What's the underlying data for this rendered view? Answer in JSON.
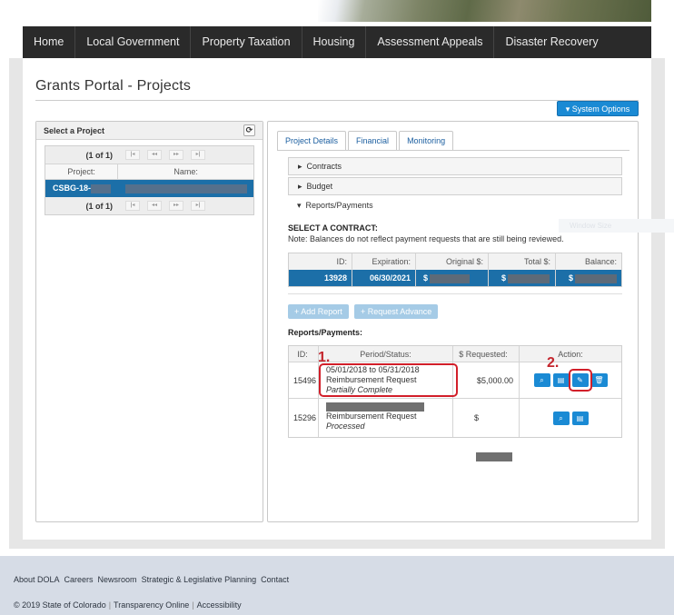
{
  "nav": [
    "Home",
    "Local Government",
    "Property Taxation",
    "Housing",
    "Assessment Appeals",
    "Disaster Recovery"
  ],
  "page_title": "Grants Portal - Projects",
  "system_options": "System Options",
  "left": {
    "header": "Select a Project",
    "pager_count": "(1 of 1)",
    "col_project": "Project:",
    "col_name": "Name:",
    "row_project": "CSBG-18-"
  },
  "tabs": [
    "Project Details",
    "Financial",
    "Monitoring"
  ],
  "accordions": {
    "contracts": "Contracts",
    "budget": "Budget",
    "reports": "Reports/Payments"
  },
  "select_contract": "SELECT A CONTRACT:",
  "contract_note": "Note: Balances do not reflect payment requests that are still being reviewed.",
  "contract_table": {
    "headers": [
      "ID:",
      "Expiration:",
      "Original $:",
      "Total $:",
      "Balance:"
    ],
    "row": {
      "id": "13928",
      "expiration": "06/30/2021",
      "original": "$",
      "total": "$",
      "balance": "$"
    }
  },
  "buttons": {
    "add_report": "+ Add Report",
    "request_advance": "+ Request Advance"
  },
  "reports_label": "Reports/Payments:",
  "reports_table": {
    "headers": [
      "ID:",
      "Period/Status:",
      "$ Requested:",
      "Action:"
    ],
    "rows": [
      {
        "id": "15496",
        "period": "05/01/2018 to 05/31/2018",
        "type": "Reimbursement Request",
        "status": "Partially Complete",
        "requested": "$5,000.00"
      },
      {
        "id": "15296",
        "period": "",
        "type": "Reimbursement Request",
        "status": "Processed",
        "requested": "$"
      }
    ]
  },
  "annotations": {
    "step1": "1.",
    "step2": "2."
  },
  "ghost_button": "Window Size",
  "footer": {
    "links": [
      "About DOLA",
      "Careers",
      "Newsroom",
      "Strategic & Legislative Planning",
      "Contact"
    ],
    "copyright": "© 2019 State of Colorado",
    "transparency": "Transparency Online",
    "accessibility": "Accessibility"
  }
}
